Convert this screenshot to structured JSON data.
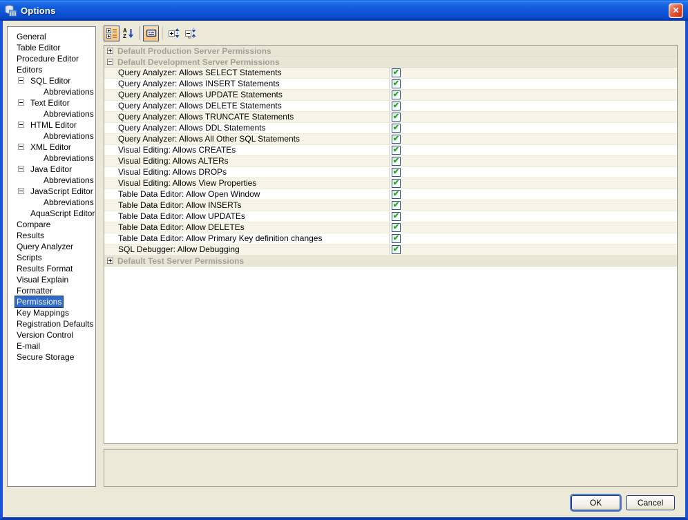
{
  "window": {
    "title": "Options"
  },
  "sidebar": {
    "items": [
      {
        "label": "General",
        "indent": 0
      },
      {
        "label": "Table Editor",
        "indent": 0
      },
      {
        "label": "Procedure Editor",
        "indent": 0
      },
      {
        "label": "Editors",
        "indent": 0
      },
      {
        "label": "SQL Editor",
        "indent": 1,
        "expander": "minus"
      },
      {
        "label": "Abbreviations",
        "indent": 2
      },
      {
        "label": "Text Editor",
        "indent": 1,
        "expander": "minus"
      },
      {
        "label": "Abbreviations",
        "indent": 2
      },
      {
        "label": "HTML Editor",
        "indent": 1,
        "expander": "minus"
      },
      {
        "label": "Abbreviations",
        "indent": 2
      },
      {
        "label": "XML Editor",
        "indent": 1,
        "expander": "minus"
      },
      {
        "label": "Abbreviations",
        "indent": 2
      },
      {
        "label": "Java Editor",
        "indent": 1,
        "expander": "minus"
      },
      {
        "label": "Abbreviations",
        "indent": 2
      },
      {
        "label": "JavaScript Editor",
        "indent": 1,
        "expander": "minus"
      },
      {
        "label": "Abbreviations",
        "indent": 2
      },
      {
        "label": "AquaScript Editor",
        "indent": 1
      },
      {
        "label": "Compare",
        "indent": 0
      },
      {
        "label": "Results",
        "indent": 0
      },
      {
        "label": "Query Analyzer",
        "indent": 0
      },
      {
        "label": "Scripts",
        "indent": 0
      },
      {
        "label": "Results Format",
        "indent": 0
      },
      {
        "label": "Visual Explain",
        "indent": 0
      },
      {
        "label": "Formatter",
        "indent": 0
      },
      {
        "label": "Permissions",
        "indent": 0,
        "selected": true
      },
      {
        "label": "Key Mappings",
        "indent": 0
      },
      {
        "label": "Registration Defaults",
        "indent": 0
      },
      {
        "label": "Version Control",
        "indent": 0
      },
      {
        "label": "E-mail",
        "indent": 0
      },
      {
        "label": "Secure Storage",
        "indent": 0
      }
    ]
  },
  "toolbar": {
    "buttons": [
      {
        "name": "categorized-view",
        "toggled": true
      },
      {
        "name": "sort-alphabetical",
        "toggled": false
      },
      {
        "name": "show-descriptions",
        "toggled": true
      },
      {
        "name": "expand-all",
        "toggled": false
      },
      {
        "name": "collapse-all",
        "toggled": false
      }
    ]
  },
  "grid": {
    "sections": [
      {
        "label": "Default Production Server Permissions",
        "expanded": false,
        "rows": []
      },
      {
        "label": "Default Development Server Permissions",
        "expanded": true,
        "rows": [
          {
            "label": "Query Analyzer: Allows SELECT Statements",
            "checked": true
          },
          {
            "label": "Query Analyzer: Allows INSERT Statements",
            "checked": true
          },
          {
            "label": "Query Analyzer: Allows UPDATE Statements",
            "checked": true
          },
          {
            "label": "Query Analyzer: Allows DELETE Statements",
            "checked": true
          },
          {
            "label": "Query Analyzer: Allows TRUNCATE Statements",
            "checked": true
          },
          {
            "label": "Query Analyzer: Allows DDL Statements",
            "checked": true
          },
          {
            "label": "Query Analyzer: Allows All Other SQL Statements",
            "checked": true
          },
          {
            "label": "Visual Editing: Allows CREATEs",
            "checked": true
          },
          {
            "label": "Visual Editing: Allows ALTERs",
            "checked": true
          },
          {
            "label": "Visual Editing: Allows DROPs",
            "checked": true
          },
          {
            "label": "Visual Editing: Allows View Properties",
            "checked": true
          },
          {
            "label": "Table Data Editor: Allow Open Window",
            "checked": true
          },
          {
            "label": "Table Data Editor: Allow INSERTs",
            "checked": true
          },
          {
            "label": "Table Data Editor: Allow UPDATEs",
            "checked": true
          },
          {
            "label": "Table Data Editor: Allow DELETEs",
            "checked": true
          },
          {
            "label": "Table Data Editor: Allow Primary Key definition changes",
            "checked": true
          },
          {
            "label": "SQL Debugger: Allow Debugging",
            "checked": true
          }
        ]
      },
      {
        "label": "Default Test Server Permissions",
        "expanded": false,
        "rows": []
      }
    ]
  },
  "footer": {
    "ok_label": "OK",
    "cancel_label": "Cancel"
  },
  "colors": {
    "titlebar_blue": "#1560de",
    "window_border": "#1a53d8",
    "panel_bg": "#ece9d8",
    "selection_blue": "#316ac5",
    "row_alt_cream": "#f6f5e8",
    "category_text": "#a3a298",
    "toggle_orange": "#fccf8e",
    "check_green": "#1ea21e",
    "checkbox_border": "#23538a"
  },
  "check_glyph": "✔"
}
